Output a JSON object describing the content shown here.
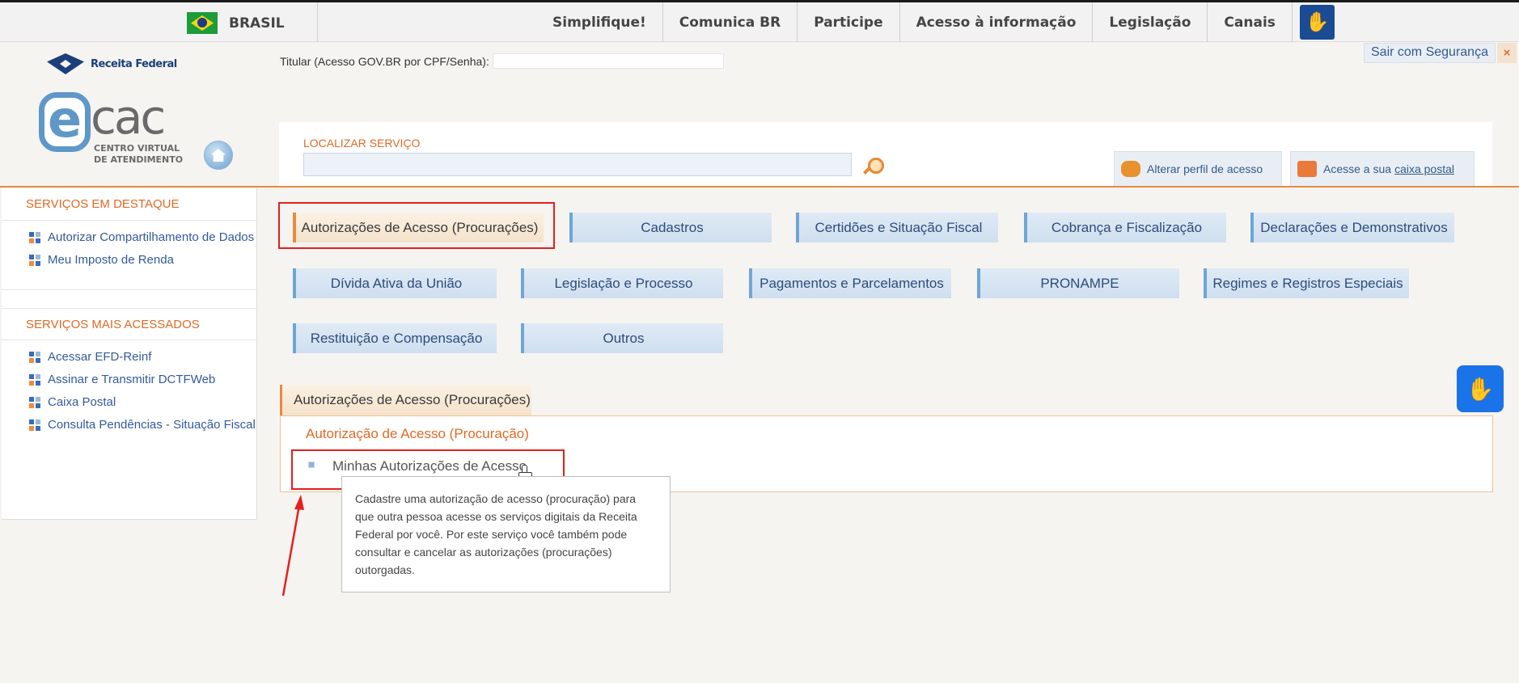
{
  "govbar": {
    "country": "BRASIL",
    "nav": [
      "Simplifique!",
      "Comunica BR",
      "Participe",
      "Acesso à informação",
      "Legislação",
      "Canais"
    ]
  },
  "header": {
    "logo_text": "Receita Federal",
    "ecac_e": "e",
    "ecac_cac": "cac",
    "ecac_sub": "CENTRO VIRTUAL DE ATENDIMENTO",
    "titular_label": "Titular (Acesso GOV.BR por CPF/Senha):",
    "sair_label": "Sair com Segurança",
    "sair_x": "×",
    "search_label": "LOCALIZAR SERVIÇO",
    "perfil_label": "Alterar perfil de acesso",
    "caixa_prefix": "Acesse a sua",
    "caixa_link": "caixa postal"
  },
  "sidebar": {
    "destaque_title": "SERVIÇOS EM DESTAQUE",
    "destaque_items": [
      "Autorizar Compartilhamento de Dados",
      "Meu Imposto de Renda"
    ],
    "acessados_title": "SERVIÇOS MAIS ACESSADOS",
    "acessados_items": [
      "Acessar EFD-Reinf",
      "Assinar e Transmitir DCTFWeb",
      "Caixa Postal",
      "Consulta Pendências - Situação Fiscal"
    ]
  },
  "categories": [
    "Autorizações de Acesso (Procurações)",
    "Cadastros",
    "Certidões e Situação Fiscal",
    "Cobrança e Fiscalização",
    "Declarações e Demonstrativos",
    "Dívida Ativa da União",
    "Legislação e Processo",
    "Pagamentos e Parcelamentos",
    "PRONAMPE",
    "Regimes e Registros Especiais",
    "Restituição e Compensação",
    "Outros"
  ],
  "panel": {
    "tab_label": "Autorizações de Acesso (Procurações)",
    "section_title": "Autorização de Acesso (Procuração)",
    "item_label": "Minhas Autorizações de Acesso",
    "tooltip": "Cadastre uma autorização de acesso (procuração) para que outra pessoa acesse os serviços digitais da Receita Federal por você. Por este serviço você também pode consultar e cancelar as autorizações (procurações) outorgadas."
  },
  "colors": {
    "accent_orange": "#e06a26",
    "link_blue": "#335a9b",
    "highlight_red": "#e3201c"
  }
}
